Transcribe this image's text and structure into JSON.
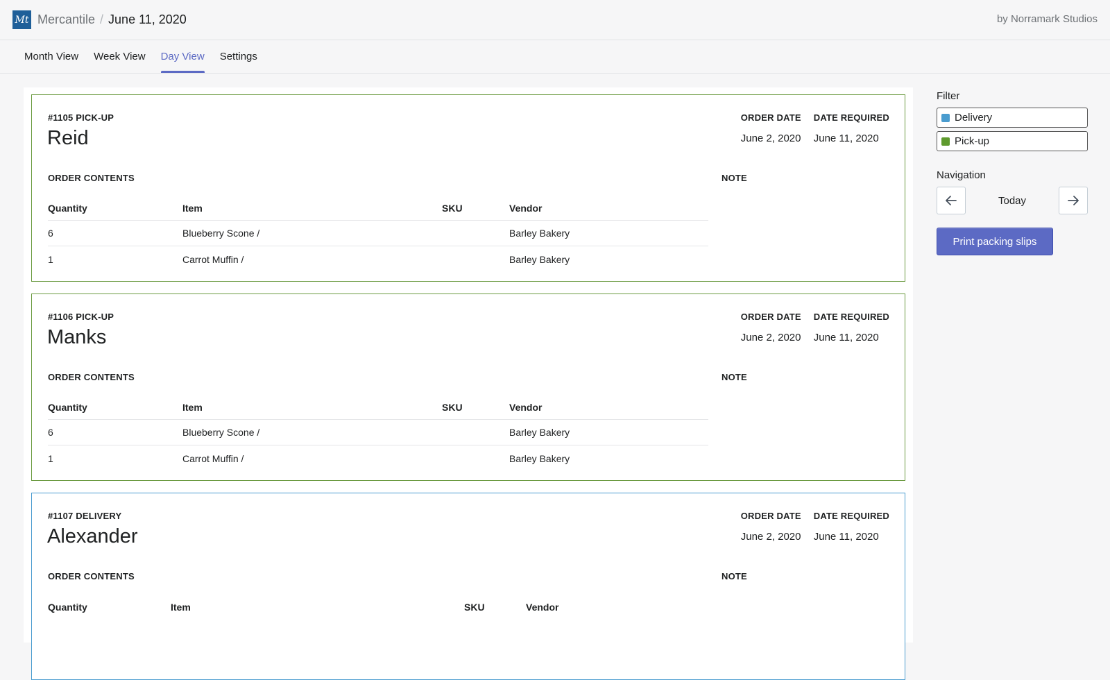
{
  "header": {
    "logo_text": "Mt",
    "app_name": "Mercantile",
    "separator": "/",
    "date": "June 11, 2020",
    "byline": "by Norramark Studios"
  },
  "tabs": [
    {
      "label": "Month View",
      "active": false
    },
    {
      "label": "Week View",
      "active": false
    },
    {
      "label": "Day View",
      "active": true
    },
    {
      "label": "Settings",
      "active": false
    }
  ],
  "labels": {
    "order_date": "ORDER DATE",
    "date_required": "DATE REQUIRED",
    "order_contents": "ORDER CONTENTS",
    "note": "NOTE",
    "col_quantity": "Quantity",
    "col_item": "Item",
    "col_sku": "SKU",
    "col_vendor": "Vendor"
  },
  "orders": [
    {
      "kind": "#1105 PICK-UP",
      "name": "Reid",
      "order_date": "June 2, 2020",
      "date_required": "June 11, 2020",
      "items": [
        {
          "quantity": "6",
          "item": "Blueberry Scone /",
          "sku": "",
          "vendor": "Barley Bakery"
        },
        {
          "quantity": "1",
          "item": "Carrot Muffin /",
          "sku": "",
          "vendor": "Barley Bakery"
        }
      ]
    },
    {
      "kind": "#1106 PICK-UP",
      "name": "Manks",
      "order_date": "June 2, 2020",
      "date_required": "June 11, 2020",
      "items": [
        {
          "quantity": "6",
          "item": "Blueberry Scone /",
          "sku": "",
          "vendor": "Barley Bakery"
        },
        {
          "quantity": "1",
          "item": "Carrot Muffin /",
          "sku": "",
          "vendor": "Barley Bakery"
        }
      ]
    },
    {
      "kind": "#1107 DELIVERY",
      "name": "Alexander",
      "order_date": "June 2, 2020",
      "date_required": "June 11, 2020",
      "items": []
    }
  ],
  "sidebar": {
    "filter_heading": "Filter",
    "filters": [
      {
        "label": "Delivery",
        "color": "#4a9ccf"
      },
      {
        "label": "Pick-up",
        "color": "#5e9a2e"
      }
    ],
    "navigation_heading": "Navigation",
    "prev_icon": "arrow-left-icon",
    "next_icon": "arrow-right-icon",
    "today_label": "Today",
    "print_label": "Print packing slips"
  },
  "colors": {
    "accent": "#5c6ac4",
    "pickup_border": "#6a9a3f",
    "delivery_border": "#4a9ccf",
    "logo_bg": "#1f5f99"
  }
}
